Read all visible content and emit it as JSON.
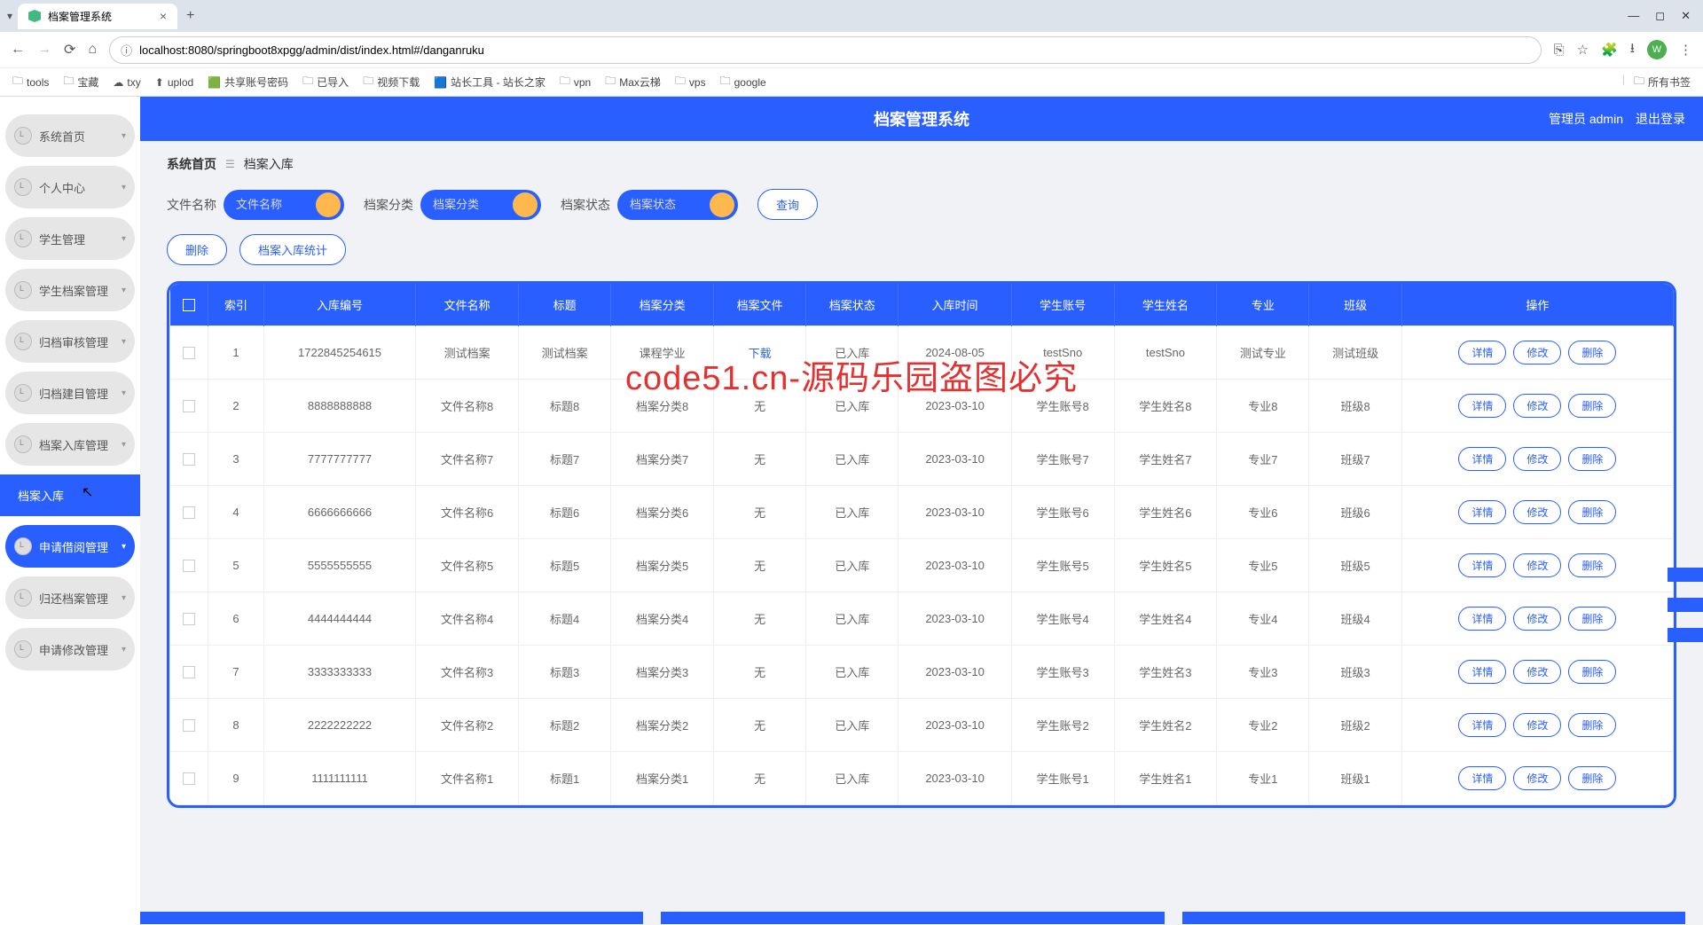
{
  "browser": {
    "tab_title": "档案管理系统",
    "url": "localhost:8080/springboot8xpgg/admin/dist/index.html#/danganruku",
    "avatar_letter": "W",
    "bookmarks": [
      "tools",
      "宝藏",
      "txy",
      "uplod",
      "共享账号密码",
      "已导入",
      "视频下载",
      "站长工具 - 站长之家",
      "vpn",
      "Max云梯",
      "vps",
      "google"
    ],
    "bookmarks_right": "所有书签"
  },
  "header": {
    "title": "档案管理系统",
    "user_label": "管理员 admin",
    "logout": "退出登录"
  },
  "sidebar": {
    "items": [
      "系统首页",
      "个人中心",
      "学生管理",
      "学生档案管理",
      "归档审核管理",
      "归档建目管理",
      "档案入库管理",
      "档案入库",
      "申请借阅管理",
      "归还档案管理",
      "申请修改管理"
    ]
  },
  "breadcrumb": {
    "home": "系统首页",
    "current": "档案入库"
  },
  "filters": {
    "file_name_label": "文件名称",
    "file_name_ph": "文件名称",
    "category_label": "档案分类",
    "category_ph": "档案分类",
    "status_label": "档案状态",
    "status_ph": "档案状态",
    "search_btn": "查询"
  },
  "actions": {
    "delete": "删除",
    "stats": "档案入库统计"
  },
  "table": {
    "headers": [
      "索引",
      "入库编号",
      "文件名称",
      "标题",
      "档案分类",
      "档案文件",
      "档案状态",
      "入库时间",
      "学生账号",
      "学生姓名",
      "专业",
      "班级",
      "操作"
    ],
    "action_labels": {
      "detail": "详情",
      "edit": "修改",
      "delete": "删除",
      "download": "下载",
      "none": "无"
    },
    "rows": [
      {
        "idx": "1",
        "code": "1722845254615",
        "fname": "测试档案",
        "title": "测试档案",
        "cat": "课程学业",
        "file": "下载",
        "file_link": true,
        "status": "已入库",
        "date": "2024-08-05",
        "acc": "testSno",
        "sname": "testSno",
        "major": "测试专业",
        "cls": "测试班级"
      },
      {
        "idx": "2",
        "code": "8888888888",
        "fname": "文件名称8",
        "title": "标题8",
        "cat": "档案分类8",
        "file": "无",
        "status": "已入库",
        "date": "2023-03-10",
        "acc": "学生账号8",
        "sname": "学生姓名8",
        "major": "专业8",
        "cls": "班级8"
      },
      {
        "idx": "3",
        "code": "7777777777",
        "fname": "文件名称7",
        "title": "标题7",
        "cat": "档案分类7",
        "file": "无",
        "status": "已入库",
        "date": "2023-03-10",
        "acc": "学生账号7",
        "sname": "学生姓名7",
        "major": "专业7",
        "cls": "班级7"
      },
      {
        "idx": "4",
        "code": "6666666666",
        "fname": "文件名称6",
        "title": "标题6",
        "cat": "档案分类6",
        "file": "无",
        "status": "已入库",
        "date": "2023-03-10",
        "acc": "学生账号6",
        "sname": "学生姓名6",
        "major": "专业6",
        "cls": "班级6"
      },
      {
        "idx": "5",
        "code": "5555555555",
        "fname": "文件名称5",
        "title": "标题5",
        "cat": "档案分类5",
        "file": "无",
        "status": "已入库",
        "date": "2023-03-10",
        "acc": "学生账号5",
        "sname": "学生姓名5",
        "major": "专业5",
        "cls": "班级5"
      },
      {
        "idx": "6",
        "code": "4444444444",
        "fname": "文件名称4",
        "title": "标题4",
        "cat": "档案分类4",
        "file": "无",
        "status": "已入库",
        "date": "2023-03-10",
        "acc": "学生账号4",
        "sname": "学生姓名4",
        "major": "专业4",
        "cls": "班级4"
      },
      {
        "idx": "7",
        "code": "3333333333",
        "fname": "文件名称3",
        "title": "标题3",
        "cat": "档案分类3",
        "file": "无",
        "status": "已入库",
        "date": "2023-03-10",
        "acc": "学生账号3",
        "sname": "学生姓名3",
        "major": "专业3",
        "cls": "班级3"
      },
      {
        "idx": "8",
        "code": "2222222222",
        "fname": "文件名称2",
        "title": "标题2",
        "cat": "档案分类2",
        "file": "无",
        "status": "已入库",
        "date": "2023-03-10",
        "acc": "学生账号2",
        "sname": "学生姓名2",
        "major": "专业2",
        "cls": "班级2"
      },
      {
        "idx": "9",
        "code": "1111111111",
        "fname": "文件名称1",
        "title": "标题1",
        "cat": "档案分类1",
        "file": "无",
        "status": "已入库",
        "date": "2023-03-10",
        "acc": "学生账号1",
        "sname": "学生姓名1",
        "major": "专业1",
        "cls": "班级1"
      }
    ]
  },
  "watermark": "code51.cn-源码乐园盗图必究"
}
